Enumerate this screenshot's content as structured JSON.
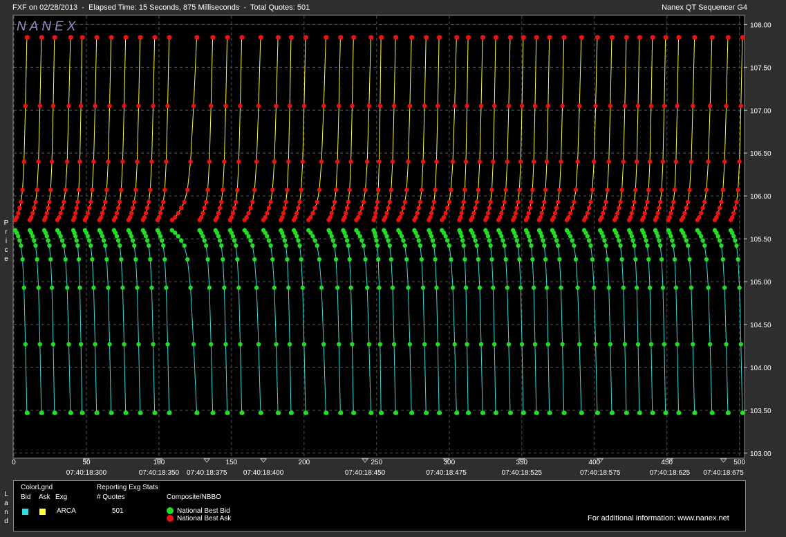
{
  "header": {
    "left_title": "FXF on 02/28/2013  -  Elapsed Time: 15 Seconds, 875 Milliseconds  -  Total Quotes: 501",
    "right_title": "Nanex QT Sequencer G4",
    "logo": "NANEX"
  },
  "y_axis_label": "Price",
  "legend_side_label": "Land",
  "colors": {
    "bid_line": "#33dddd",
    "ask_line": "#ffff33",
    "nbb": "#22dd22",
    "nbo": "#ee1111",
    "grid": "#555555",
    "plot_bg": "#000000"
  },
  "chart_data": {
    "type": "scatter",
    "title": "",
    "xlabel": "",
    "ylabel": "Price",
    "xlim": [
      0,
      503
    ],
    "ylim": [
      102.95,
      108.1
    ],
    "grid": true,
    "x_ticks": [
      0,
      50,
      100,
      150,
      200,
      250,
      300,
      350,
      400,
      450,
      500
    ],
    "x_tick_labels": [
      "0",
      "50",
      "100",
      "150",
      "200",
      "250",
      "300",
      "350",
      "400",
      "450",
      "500"
    ],
    "y_ticks": [
      103.0,
      103.5,
      104.0,
      104.5,
      105.0,
      105.5,
      106.0,
      106.5,
      107.0,
      107.5,
      108.0
    ],
    "y_tick_labels": [
      "103.00",
      "103.50",
      "104.00",
      "104.50",
      "105.00",
      "105.50",
      "106.00",
      "106.50",
      "107.00",
      "107.50",
      "108.00"
    ],
    "time_labels": [
      {
        "x": 50,
        "label": "07:40:18:300"
      },
      {
        "x": 100,
        "label": "07:40:18:350"
      },
      {
        "x": 133,
        "label": "07:40:18:375"
      },
      {
        "x": 172,
        "label": "07:40:18:400"
      },
      {
        "x": 242,
        "label": "07:40:18:450"
      },
      {
        "x": 298,
        "label": "07:40:18:475"
      },
      {
        "x": 350,
        "label": "07:40:18:525"
      },
      {
        "x": 404,
        "label": "07:40:18:575"
      },
      {
        "x": 452,
        "label": "07:40:18:625"
      },
      {
        "x": 489,
        "label": "07:40:18:675"
      }
    ],
    "cycle_starts": [
      0,
      10,
      20,
      29,
      40,
      48,
      58,
      68,
      78,
      88,
      98,
      108,
      127,
      138,
      148,
      158,
      171,
      183,
      192,
      202,
      216,
      226,
      235,
      247,
      254,
      264,
      275,
      285,
      294,
      306,
      314,
      324,
      333,
      343,
      352,
      361,
      370,
      380,
      392,
      403,
      413,
      423,
      432,
      441,
      450,
      459,
      470,
      482,
      493
    ],
    "series": [
      {
        "name": "National Best Bid",
        "high_price": 105.6,
        "low_price": 103.47,
        "levels": [
          105.6,
          105.57,
          105.53,
          105.48,
          105.42,
          105.26,
          104.93,
          104.27,
          103.47
        ]
      },
      {
        "name": "National Best Ask",
        "high_price": 107.85,
        "low_price": 105.72,
        "levels": [
          105.72,
          105.75,
          105.8,
          105.86,
          105.93,
          106.07,
          106.4,
          107.05,
          107.85
        ]
      }
    ]
  },
  "legend": {
    "color_legend_title": "ColorLgnd",
    "col_bid": "Bid",
    "col_ask": "Ask",
    "col_exg": "Exg",
    "exchange": "ARCA",
    "stats_title": "Reporting Exg Stats",
    "stats_col": "# Quotes",
    "quotes_count": "501",
    "composite_title": "Composite/NBBO",
    "nbb_label": "National Best Bid",
    "nbo_label": "National Best Ask",
    "info": "For additional information: www.nanex.net"
  }
}
